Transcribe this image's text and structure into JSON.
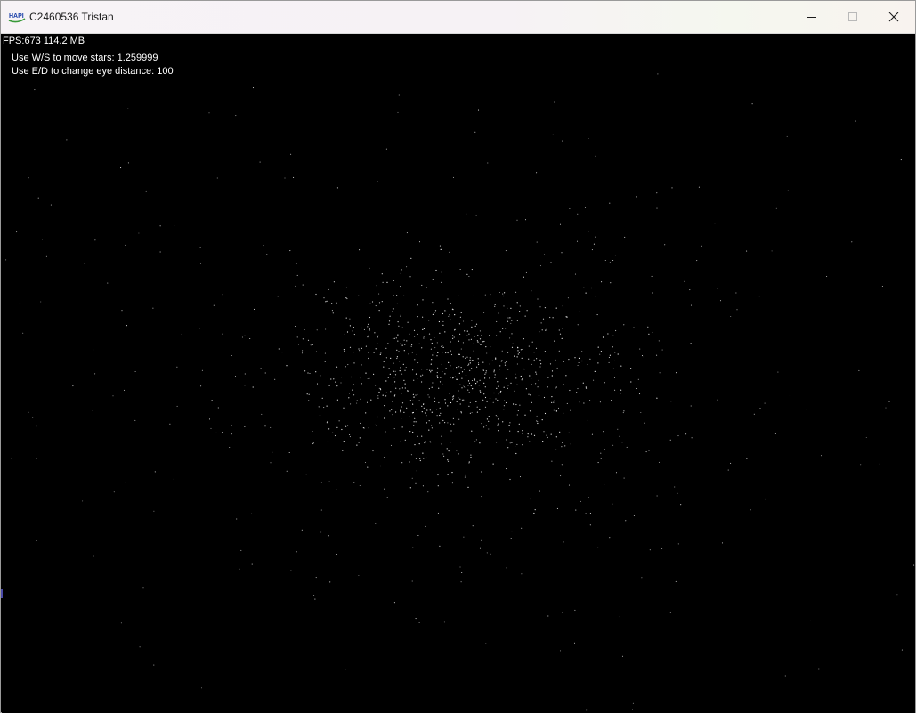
{
  "window": {
    "title": "C2460536 Tristan",
    "icon": "hapi-logo-icon",
    "icon_text": "HAPI",
    "controls": {
      "minimize": "minimize-icon",
      "maximize": "maximize-icon",
      "close": "close-icon"
    }
  },
  "hud": {
    "fps_line": "FPS:673 114.2 MB",
    "move_stars_line": "Use W/S to move stars: 1.259999",
    "eye_distance_line": "Use E/D to change eye distance: 100"
  },
  "colors": {
    "background": "#000000",
    "star": "#ffffff",
    "hud_text": "#ffffff",
    "titlebar": "#f6f2f5"
  }
}
